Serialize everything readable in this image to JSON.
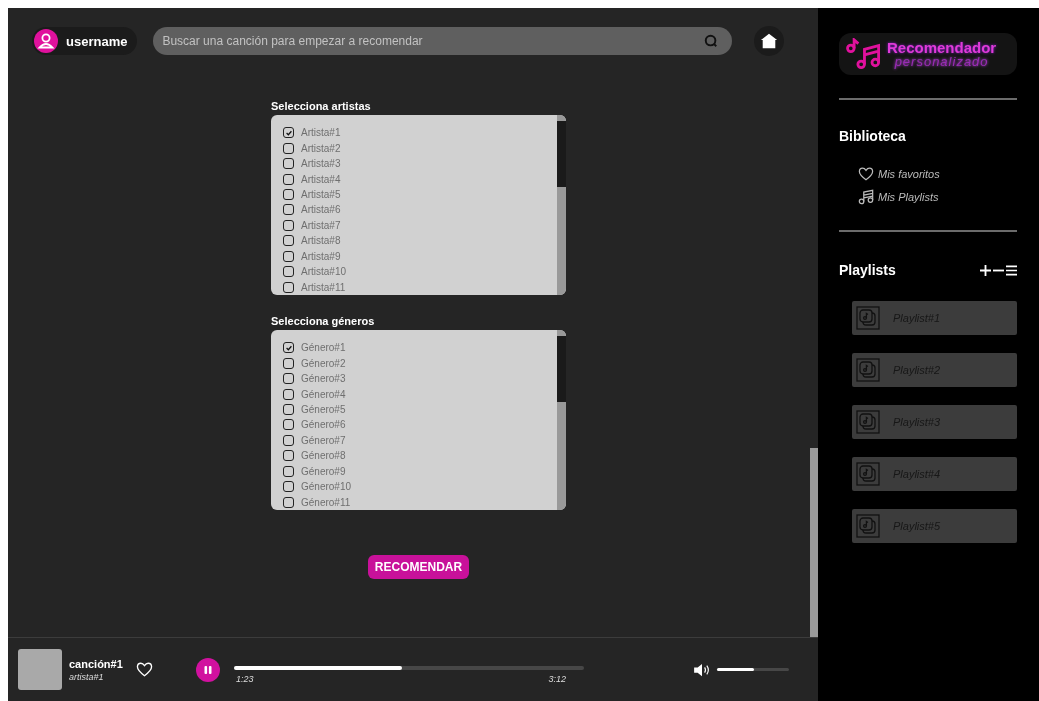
{
  "topbar": {
    "username": "username",
    "search": {
      "placeholder": "Buscar una canción para empezar a recomendar"
    }
  },
  "selectors": [
    {
      "title": "Selecciona artistas",
      "options": [
        {
          "label": "Artista#1",
          "checked": true
        },
        {
          "label": "Artista#2",
          "checked": false
        },
        {
          "label": "Artista#3",
          "checked": false
        },
        {
          "label": "Artista#4",
          "checked": false
        },
        {
          "label": "Artista#5",
          "checked": false
        },
        {
          "label": "Artista#6",
          "checked": false
        },
        {
          "label": "Artista#7",
          "checked": false
        },
        {
          "label": "Artista#8",
          "checked": false
        },
        {
          "label": "Artista#9",
          "checked": false
        },
        {
          "label": "Artista#10",
          "checked": false
        },
        {
          "label": "Artista#11",
          "checked": false
        }
      ]
    },
    {
      "title": "Selecciona géneros",
      "options": [
        {
          "label": "Género#1",
          "checked": true
        },
        {
          "label": "Género#2",
          "checked": false
        },
        {
          "label": "Género#3",
          "checked": false
        },
        {
          "label": "Género#4",
          "checked": false
        },
        {
          "label": "Género#5",
          "checked": false
        },
        {
          "label": "Género#6",
          "checked": false
        },
        {
          "label": "Género#7",
          "checked": false
        },
        {
          "label": "Género#8",
          "checked": false
        },
        {
          "label": "Género#9",
          "checked": false
        },
        {
          "label": "Género#10",
          "checked": false
        },
        {
          "label": "Género#11",
          "checked": false
        }
      ]
    }
  ],
  "recommend_button": "RECOMENDAR",
  "player": {
    "title": "canción#1",
    "artist": "artista#1",
    "playing": true,
    "progress": {
      "level": 0.48
    },
    "elapsed": "1:23",
    "duration": "3:12",
    "volume": {
      "level": 0.52
    }
  },
  "sidebar": {
    "logo": {
      "line_1": "Recomendador",
      "line_2": "personalizado"
    },
    "library_title": "Biblioteca",
    "library_items": [
      {
        "label": "Mis favoritos",
        "kind": "heart"
      },
      {
        "label": "Mis Playlists",
        "kind": "notes"
      }
    ],
    "playlists_title": "Playlists",
    "playlists": [
      "Playlist#1",
      "Playlist#2",
      "Playlist#3",
      "Playlist#4",
      "Playlist#5"
    ]
  }
}
